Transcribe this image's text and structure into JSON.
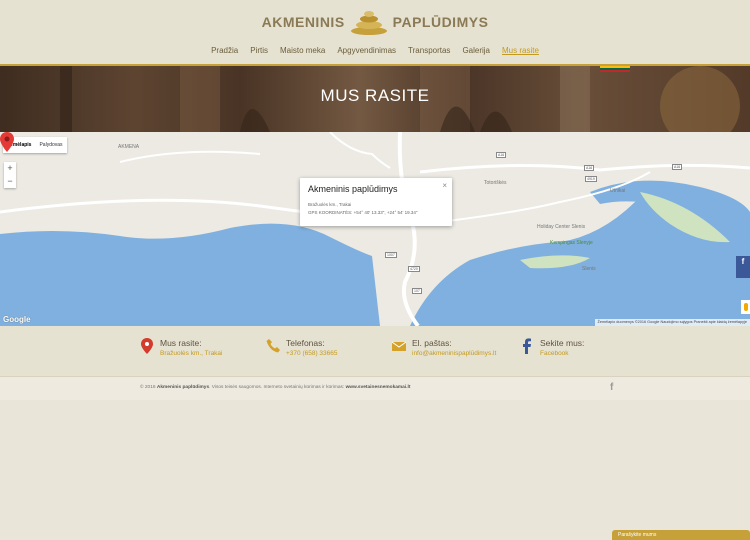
{
  "logo": {
    "left_word": "AKMENINIS",
    "right_word": "PAPLŪDIMYS"
  },
  "nav": {
    "items": [
      {
        "label": "Pradžia"
      },
      {
        "label": "Pirtis"
      },
      {
        "label": "Maisto meka"
      },
      {
        "label": "Apgyvendinimas"
      },
      {
        "label": "Transportas"
      },
      {
        "label": "Galerija"
      },
      {
        "label": "Mus rasite",
        "active": true
      }
    ]
  },
  "banner": {
    "title": "MUS RASITE"
  },
  "map": {
    "type_buttons": [
      "Žemėlapis",
      "Palydovas"
    ],
    "zoom_in": "+",
    "zoom_out": "−",
    "info": {
      "title": "Akmeninis paplūdimys",
      "address": "Bražuolės km., Trakai",
      "coords": "GPS KOORDINATĖS: +54° 40' 13.33\", +24° 54' 19.34\"",
      "close": "×"
    },
    "labels": {
      "akmena": "AKMENA",
      "totoriskes": "Totoriškės",
      "holiday": "Holiday Center Slenis",
      "kempingas": "Kempingas Slenyje",
      "slenis": "Slenis",
      "utnikai": "Utnikai"
    },
    "roads": [
      "A16",
      "A16",
      "A16",
      "4919",
      "1007",
      "4720",
      "107"
    ],
    "google": "Google",
    "attribution": "Žemėlapio duomenys ©2016 Google   Naudojimo sąlygos   Pranešti apie klaidą žemėlapyje"
  },
  "contacts": [
    {
      "title": "Mus rasite:",
      "value": "Bražuolės km., Trakai",
      "icon": "map-marker-icon"
    },
    {
      "title": "Telefonas:",
      "value": "+370 (658) 33665",
      "icon": "phone-icon"
    },
    {
      "title": "El. paštas:",
      "value": "info@akmeninispaplūdimys.lt",
      "icon": "envelope-icon"
    },
    {
      "title": "Sekite mus:",
      "value": "Facebook",
      "icon": "facebook-icon"
    }
  ],
  "footer": {
    "year": "© 2016",
    "brand": "Akmeninis paplūdimys",
    "rights": ". Visos teisės saugomos. Internetо svetainių kūrimas ir kūrimas: ",
    "maker": "www.svetainesnemokamai.lt"
  },
  "chat": {
    "label": "Parašykite mums"
  },
  "colors": {
    "accent": "#c39a1e",
    "brand": "#8a7a55",
    "water": "#7fb0df",
    "facebook": "#3b5998"
  }
}
